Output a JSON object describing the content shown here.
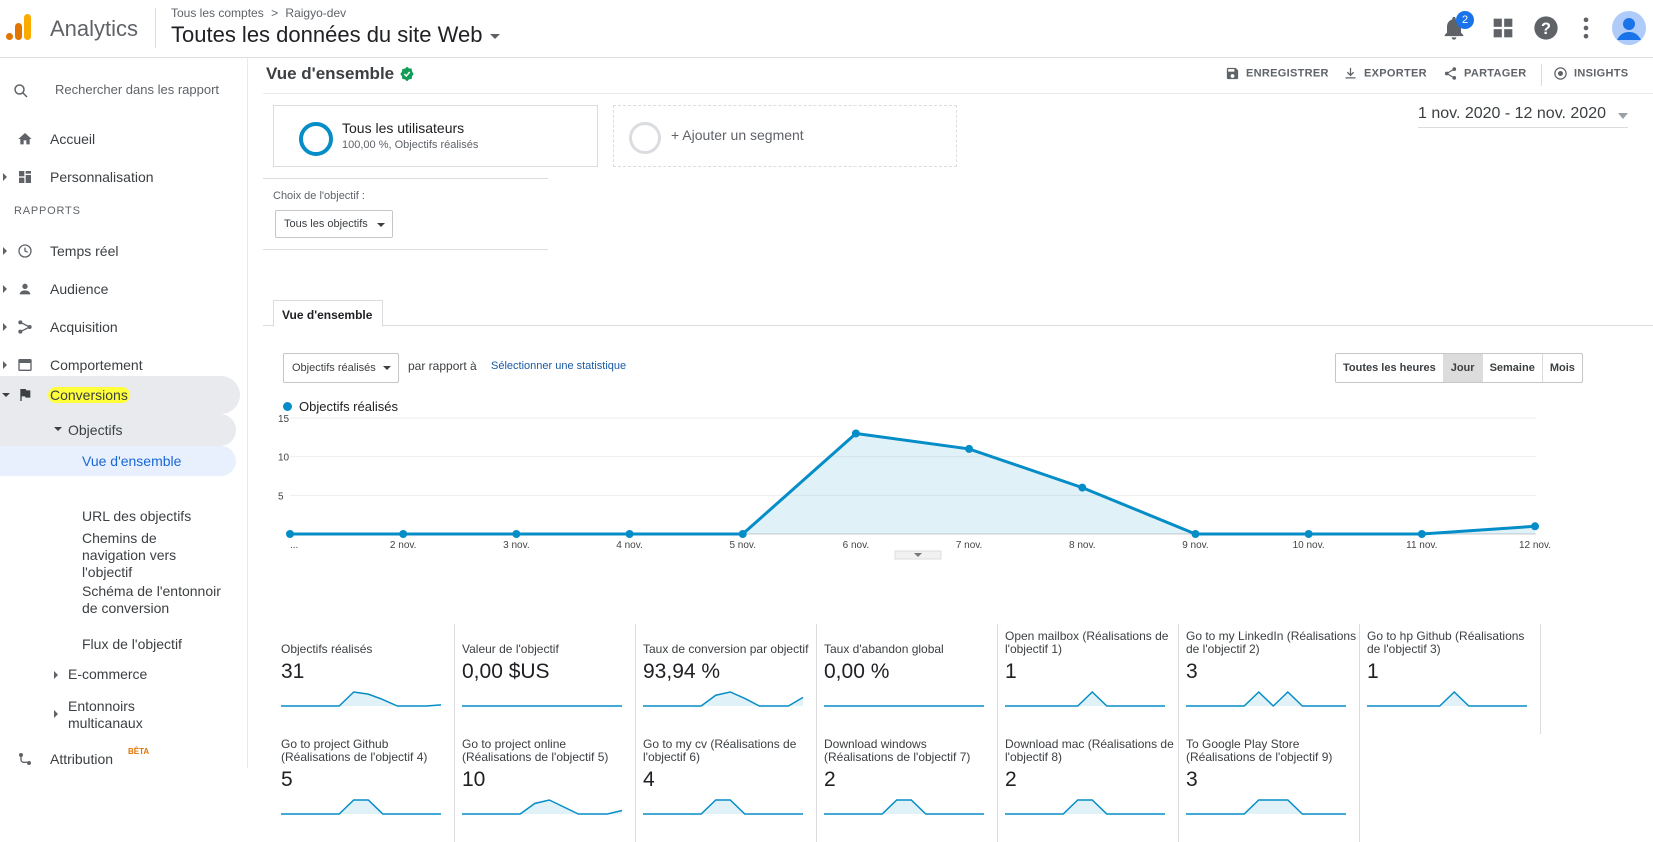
{
  "app": {
    "title": "Analytics"
  },
  "breadcrumb": {
    "accounts": "Tous les comptes",
    "separator": ">",
    "property": "Raigyo-dev"
  },
  "view": {
    "title": "Toutes les données du site Web"
  },
  "notifications": {
    "count": "2"
  },
  "colors": {
    "accent": "#058dc7",
    "highlight": "#ffff3a",
    "link": "#1a5aa4",
    "brand_orange": "#f9ab00",
    "brand_dark_orange": "#e37400"
  },
  "sidebar": {
    "search_placeholder": "Rechercher dans les rapport",
    "home": "Accueil",
    "customization": "Personnalisation",
    "reports_label": "RAPPORTS",
    "realtime": "Temps réel",
    "audience": "Audience",
    "acquisition": "Acquisition",
    "behavior": "Comportement",
    "conversions": "Conversions",
    "goals": "Objectifs",
    "goals_sub": [
      "Vue d'ensemble",
      "URL des objectifs",
      "Chemins de navigation vers l'objectif",
      "Schéma de l'entonnoir de conversion",
      "Flux de l'objectif"
    ],
    "ecommerce": "E-commerce",
    "multichannel": "Entonnoirs multicanaux",
    "attribution": "Attribution",
    "attribution_badge": "BÊTA"
  },
  "header": {
    "page_title": "Vue d'ensemble",
    "save": "ENREGISTRER",
    "export": "EXPORTER",
    "share": "PARTAGER",
    "insights": "INSIGHTS"
  },
  "segments": {
    "all_users": "Tous les utilisateurs",
    "all_users_sub": "100,00 %, Objectifs réalisés",
    "add": "+ Ajouter un segment"
  },
  "date_range": "1 nov. 2020 - 12 nov. 2020",
  "goal_option": {
    "label": "Choix de l'objectif :",
    "value": "Tous les objectifs"
  },
  "tabs": {
    "overview": "Vue d'ensemble"
  },
  "controls": {
    "metric": "Objectifs réalisés",
    "vs": "par rapport à",
    "select_metric": "Sélectionner une statistique",
    "granularity": [
      "Toutes les heures",
      "Jour",
      "Semaine",
      "Mois"
    ],
    "granularity_selected": "Jour"
  },
  "chart_data": {
    "type": "area",
    "series": [
      {
        "name": "Objectifs réalisés",
        "values": [
          0,
          0,
          0,
          0,
          0,
          13,
          11,
          6,
          0,
          0,
          0,
          1
        ]
      }
    ],
    "categories": [
      "...",
      "2 nov.",
      "3 nov.",
      "4 nov.",
      "5 nov.",
      "6 nov.",
      "7 nov.",
      "8 nov.",
      "9 nov.",
      "10 nov.",
      "11 nov.",
      "12 nov."
    ],
    "yticks": [
      "15",
      "10",
      "5"
    ],
    "ylim": [
      0,
      15
    ],
    "grid": true
  },
  "tiles": [
    {
      "label": "Objectifs réalisés",
      "value": "31",
      "spark": [
        0,
        0,
        0,
        0,
        0,
        13,
        11,
        6,
        0,
        0,
        0,
        1
      ]
    },
    {
      "label": "Valeur de l'objectif",
      "value": "0,00 $US",
      "spark": [
        0,
        0,
        0,
        0,
        0,
        0,
        0,
        0,
        0,
        0,
        0,
        0
      ]
    },
    {
      "label": "Taux de conversion par objectif",
      "value": "93,94 %",
      "spark": [
        0,
        0,
        0,
        0,
        0,
        10,
        13,
        7,
        0,
        0,
        0,
        8
      ]
    },
    {
      "label": "Taux d'abandon global",
      "value": "0,00 %",
      "spark": [
        0,
        0,
        0,
        0,
        0,
        0,
        0,
        0,
        0,
        0,
        0,
        0
      ]
    },
    {
      "label": "Open mailbox (Réalisations de l'objectif 1)",
      "value": "1",
      "spark": [
        0,
        0,
        0,
        0,
        0,
        0,
        1,
        0,
        0,
        0,
        0,
        0
      ]
    },
    {
      "label": "Go to my LinkedIn (Réalisations de l'objectif 2)",
      "value": "3",
      "spark": [
        0,
        0,
        0,
        0,
        0,
        1,
        0,
        1,
        0,
        0,
        0,
        0
      ]
    },
    {
      "label": "Go to hp Github (Réalisations de l'objectif 3)",
      "value": "1",
      "spark": [
        0,
        0,
        0,
        0,
        0,
        0,
        1,
        0,
        0,
        0,
        0,
        0
      ]
    },
    {
      "label": "Go to project Github (Réalisations de l'objectif 4)",
      "value": "5",
      "spark": [
        0,
        0,
        0,
        0,
        0,
        3,
        3,
        0,
        0,
        0,
        0,
        0
      ]
    },
    {
      "label": "Go to project online (Réalisations de l'objectif 5)",
      "value": "10",
      "spark": [
        0,
        0,
        0,
        0,
        0,
        3,
        4,
        2,
        0,
        0,
        0,
        1
      ]
    },
    {
      "label": "Go to my cv (Réalisations de l'objectif 6)",
      "value": "4",
      "spark": [
        0,
        0,
        0,
        0,
        0,
        2,
        2,
        0,
        0,
        0,
        0,
        0
      ]
    },
    {
      "label": "Download windows (Réalisations de l'objectif 7)",
      "value": "2",
      "spark": [
        0,
        0,
        0,
        0,
        0,
        1,
        1,
        0,
        0,
        0,
        0,
        0
      ]
    },
    {
      "label": "Download mac (Réalisations de l'objectif 8)",
      "value": "2",
      "spark": [
        0,
        0,
        0,
        0,
        0,
        1,
        1,
        0,
        0,
        0,
        0,
        0
      ]
    },
    {
      "label": "To Google Play Store (Réalisations de l'objectif 9)",
      "value": "3",
      "spark": [
        0,
        0,
        0,
        0,
        0,
        1,
        1,
        1,
        0,
        0,
        0,
        0
      ]
    }
  ]
}
